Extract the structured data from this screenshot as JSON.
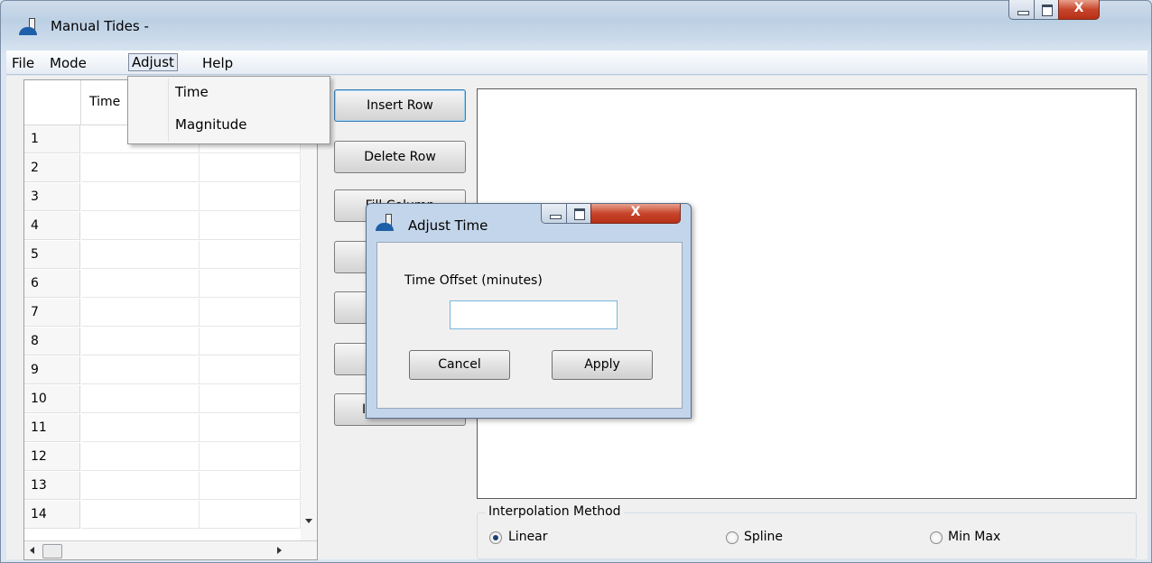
{
  "window": {
    "title": "Manual Tides -",
    "minimize": "minimize",
    "maximize": "maximize",
    "close": "X"
  },
  "menubar": {
    "items": [
      "File",
      "Mode",
      "Adjust",
      "Help"
    ],
    "active": "Adjust"
  },
  "adjust_menu": {
    "items": [
      "Time",
      "Magnitude"
    ]
  },
  "table": {
    "columns": [
      "Time",
      ""
    ],
    "rows": [
      "1",
      "2",
      "3",
      "4",
      "5",
      "6",
      "7",
      "8",
      "9",
      "10",
      "11",
      "12",
      "13",
      "14"
    ]
  },
  "buttons": {
    "insert_row": "Insert Row",
    "delete_row": "Delete Row",
    "fill_column_partial": "Fill Column",
    "partial_label_7": "I"
  },
  "interpolation": {
    "title": "Interpolation Method",
    "options": [
      "Linear",
      "Spline",
      "Min Max"
    ],
    "selected": "Linear"
  },
  "dialog": {
    "title": "Adjust Time",
    "label": "Time Offset (minutes)",
    "value": "",
    "cancel": "Cancel",
    "apply": "Apply",
    "close": "X"
  }
}
